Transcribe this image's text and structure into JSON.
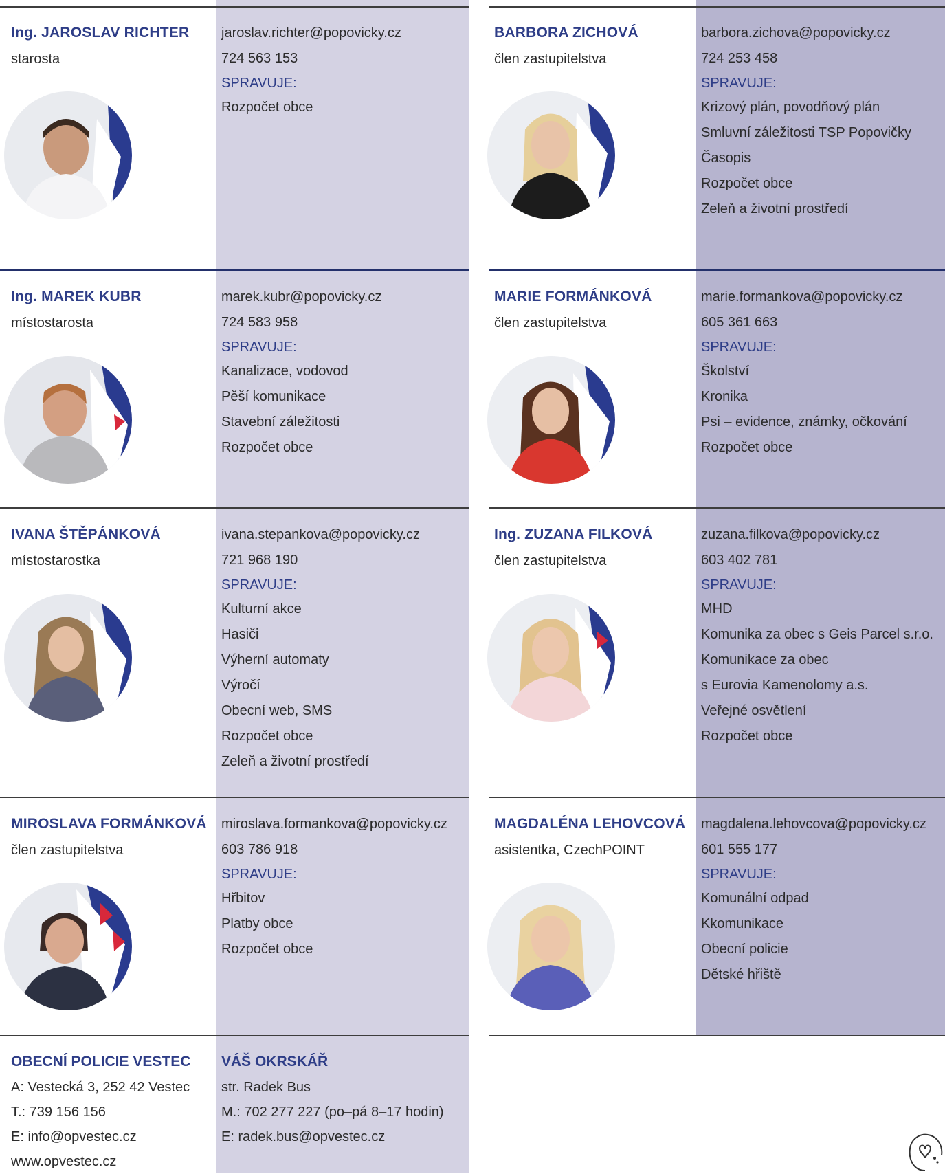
{
  "colors": {
    "accent": "#2e3d87",
    "panel_light": "#d4d2e3",
    "panel_dark": "#b6b4cf",
    "divider": "#3d3d3d"
  },
  "sprav_label": "SPRAVUJE:",
  "people": [
    {
      "name": "Ing. JAROSLAV RICHTER",
      "role": "starosta",
      "email": "jaroslav.richter@popovicky.cz",
      "phone": "724 563 153",
      "duties": [
        "Rozpočet obce"
      ],
      "photo_icon": "man-portrait-icon"
    },
    {
      "name": "BARBORA ZICHOVÁ",
      "role": "člen zastupitelstva",
      "email": "barbora.zichova@popovicky.cz",
      "phone": "724 253 458",
      "duties": [
        "Krizový plán, povodňový plán",
        "Smluvní záležitosti TSP Popovičky",
        "Časopis",
        "Rozpočet obce",
        "Zeleň a životní prostředí"
      ],
      "photo_icon": "woman-portrait-icon"
    },
    {
      "name": "Ing. MAREK KUBR",
      "role": "místostarosta",
      "email": "marek.kubr@popovicky.cz",
      "phone": "724 583 958",
      "duties": [
        "Kanalizace, vodovod",
        "Pěší komunikace",
        "Stavební záležitosti",
        "Rozpočet obce"
      ],
      "photo_icon": "man-portrait-icon"
    },
    {
      "name": "MARIE FORMÁNKOVÁ",
      "role": "člen zastupitelstva",
      "email": "marie.formankova@popovicky.cz",
      "phone": "605 361 663",
      "duties": [
        "Školství",
        "Kronika",
        "Psi – evidence, známky, očkování",
        "Rozpočet obce"
      ],
      "photo_icon": "woman-portrait-icon"
    },
    {
      "name": "IVANA ŠTĚPÁNKOVÁ",
      "role": "místostarostka",
      "email": "ivana.stepankova@popovicky.cz",
      "phone": "721 968 190",
      "duties": [
        "Kulturní akce",
        "Hasiči",
        "Výherní automaty",
        "Výročí",
        "Obecní web, SMS",
        "Rozpočet obce",
        "Zeleň a životní prostředí"
      ],
      "photo_icon": "woman-portrait-icon"
    },
    {
      "name": "Ing. ZUZANA FILKOVÁ",
      "role": "člen zastupitelstva",
      "email": "zuzana.filkova@popovicky.cz",
      "phone": "603 402 781",
      "duties": [
        "MHD",
        "Komunika za obec s Geis Parcel s.r.o.",
        "Komunikace za obec",
        "s Eurovia Kamenolomy a.s.",
        "Veřejné osvětlení",
        "Rozpočet obce"
      ],
      "photo_icon": "woman-portrait-icon"
    },
    {
      "name": "MIROSLAVA FORMÁNKOVÁ",
      "role": "člen zastupitelstva",
      "email": "miroslava.formankova@popovicky.cz",
      "phone": "603 786 918",
      "duties": [
        "Hřbitov",
        "Platby obce",
        "Rozpočet obce"
      ],
      "photo_icon": "woman-portrait-icon"
    },
    {
      "name": "MAGDALÉNA LEHOVCOVÁ",
      "role": "asistentka, CzechPOINT",
      "email": "magdalena.lehovcova@popovicky.cz",
      "phone": "601 555 177",
      "duties": [
        "Komunální odpad",
        "Kkomunikace",
        "Obecní policie",
        "Dětské hřiště"
      ],
      "photo_icon": "woman-portrait-icon"
    }
  ],
  "police": {
    "title": "OBECNÍ POLICIE VESTEC",
    "lines": [
      "A: Vestecká 3, 252 42 Vestec",
      "T.: 739 156 156",
      "E: info@opvestec.cz",
      "www.opvestec.cz"
    ]
  },
  "okrskar": {
    "title": "VÁŠ OKRSKÁŘ",
    "lines": [
      "str. Radek Bus",
      "M.: 702 277 227 (po–pá 8–17 hodin)",
      "E: radek.bus@opvestec.cz"
    ]
  },
  "corner_icon": "heart-doodle-icon"
}
